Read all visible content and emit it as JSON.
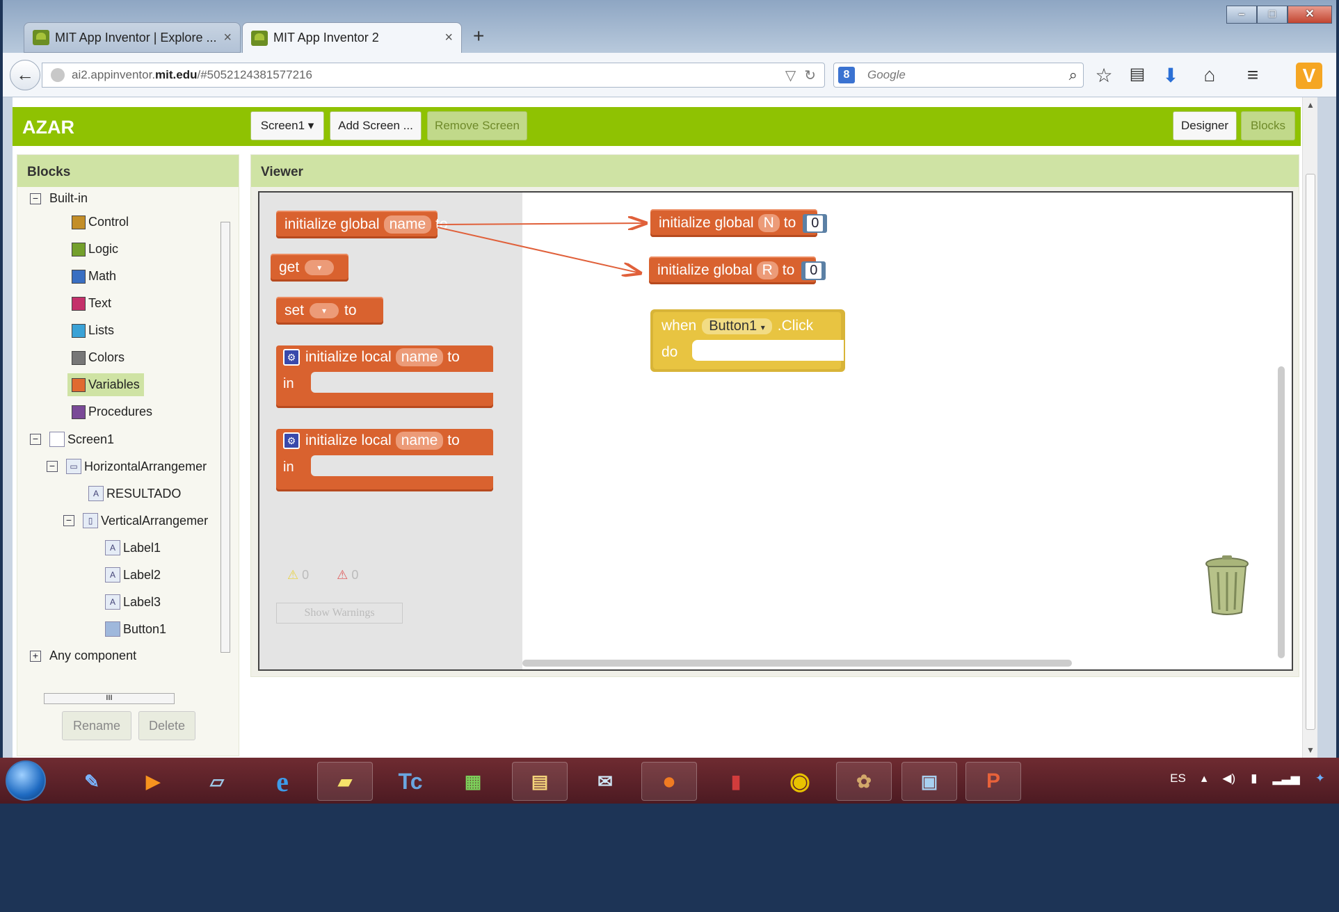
{
  "browser": {
    "tabs": [
      {
        "title": "MIT App Inventor | Explore ...",
        "active": false
      },
      {
        "title": "MIT App Inventor 2",
        "active": true
      }
    ],
    "url_prefix": "ai2.appinventor.",
    "url_domain": "mit.edu",
    "url_suffix": "/#5052124381577216",
    "search_placeholder": "Google",
    "search_engine_icon": "google-g-icon",
    "vivaldi_label": "V"
  },
  "app": {
    "project_name": "AZAR",
    "screen_select": "Screen1 ▾",
    "add_screen": "Add Screen ...",
    "remove_screen": "Remove Screen",
    "designer": "Designer",
    "blocks": "Blocks"
  },
  "blocks_panel": {
    "header": "Blocks",
    "builtin_label": "Built-in",
    "builtin": [
      {
        "label": "Control",
        "color": "#c38e28"
      },
      {
        "label": "Logic",
        "color": "#74a02c"
      },
      {
        "label": "Math",
        "color": "#3a6fc2"
      },
      {
        "label": "Text",
        "color": "#c4316a"
      },
      {
        "label": "Lists",
        "color": "#3aa2d6"
      },
      {
        "label": "Colors",
        "color": "#777777"
      },
      {
        "label": "Variables",
        "color": "#e06a30"
      },
      {
        "label": "Procedures",
        "color": "#7a4a97"
      }
    ],
    "screen_label": "Screen1",
    "components": [
      {
        "label": "HorizontalArrangemer"
      },
      {
        "label": "RESULTADO"
      },
      {
        "label": "VerticalArrangemer"
      },
      {
        "label": "Label1"
      },
      {
        "label": "Label2"
      },
      {
        "label": "Label3"
      },
      {
        "label": "Button1"
      }
    ],
    "any_component": "Any component",
    "rename": "Rename",
    "delete": "Delete"
  },
  "viewer": {
    "header": "Viewer",
    "flyout": {
      "init_global": "initialize global",
      "init_global_name": "name",
      "to": "to",
      "get": "get",
      "set": "set",
      "init_local": "initialize local",
      "init_local_name": "name",
      "in": "in"
    },
    "workspace": {
      "global_N_label": "initialize global",
      "global_N_name": "N",
      "global_N_value": "0",
      "global_R_label": "initialize global",
      "global_R_name": "R",
      "global_R_value": "0",
      "to": "to",
      "event_when": "when",
      "event_component": "Button1",
      "event_name": ".Click",
      "event_do": "do"
    },
    "warnings_count": "0",
    "errors_count": "0",
    "show_warnings": "Show Warnings"
  },
  "taskbar": {
    "language": "ES"
  }
}
